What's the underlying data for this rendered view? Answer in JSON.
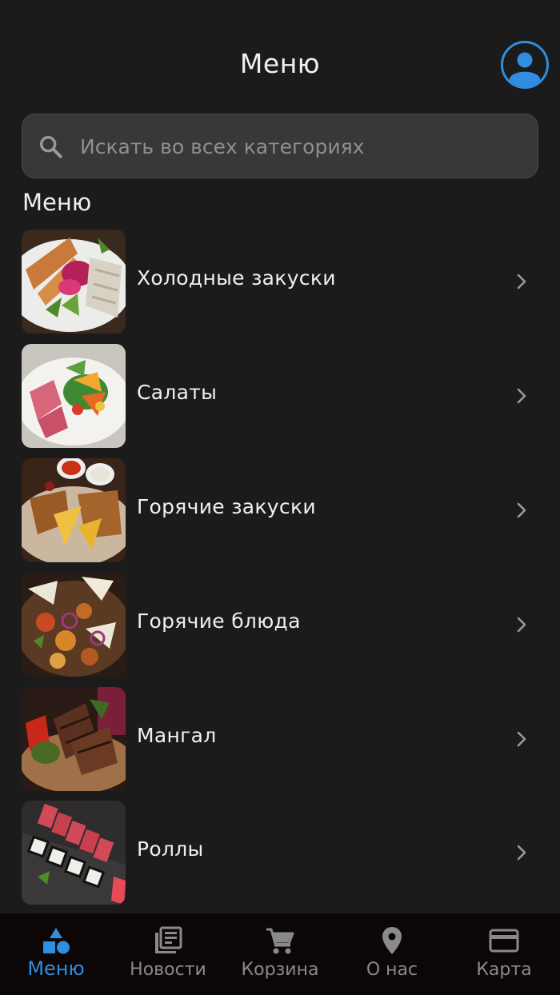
{
  "colors": {
    "accent": "#2f8ee0",
    "background": "#1b1b1b",
    "search_bg": "#383838",
    "nav_bg": "#0d0606"
  },
  "header": {
    "title": "Меню",
    "profile_icon": "account-circle-icon"
  },
  "search": {
    "placeholder": "Искать во всех категориях",
    "value": "",
    "icon": "search-icon"
  },
  "section": {
    "title": "Меню"
  },
  "categories": [
    {
      "label": "Холодные закуски",
      "image": "cold-appetizers-photo"
    },
    {
      "label": "Салаты",
      "image": "salads-photo"
    },
    {
      "label": "Горячие закуски",
      "image": "hot-appetizers-photo"
    },
    {
      "label": "Горячие блюда",
      "image": "hot-dishes-photo"
    },
    {
      "label": "Мангал",
      "image": "grill-photo"
    },
    {
      "label": "Роллы",
      "image": "rolls-photo"
    }
  ],
  "nav": {
    "active": "menu",
    "items": [
      {
        "id": "menu",
        "label": "Меню",
        "icon": "shapes-icon"
      },
      {
        "id": "news",
        "label": "Новости",
        "icon": "news-icon"
      },
      {
        "id": "cart",
        "label": "Корзина",
        "icon": "cart-icon"
      },
      {
        "id": "about",
        "label": "О нас",
        "icon": "location-pin-icon"
      },
      {
        "id": "card",
        "label": "Карта",
        "icon": "credit-card-icon"
      }
    ]
  }
}
